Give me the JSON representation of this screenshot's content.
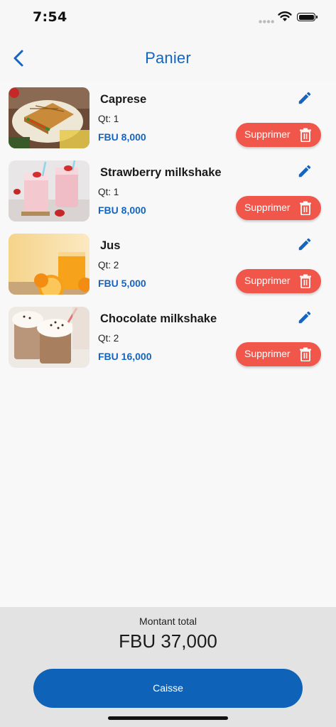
{
  "status_bar": {
    "time": "7:54"
  },
  "header": {
    "title": "Panier"
  },
  "cart": {
    "items": [
      {
        "name": "Caprese",
        "qty": "Qt: 1",
        "price": "FBU 8,000",
        "delete_label": "Supprimer",
        "image": "caprese-sandwich"
      },
      {
        "name": "Strawberry milkshake",
        "qty": "Qt: 1",
        "price": "FBU 8,000",
        "delete_label": "Supprimer",
        "image": "strawberry-milkshake"
      },
      {
        "name": "Jus",
        "qty": "Qt: 2",
        "price": "FBU 5,000",
        "delete_label": "Supprimer",
        "image": "orange-juice"
      },
      {
        "name": "Chocolate milkshake",
        "qty": "Qt: 2",
        "price": "FBU 16,000",
        "delete_label": "Supprimer",
        "image": "chocolate-milkshake"
      }
    ]
  },
  "footer": {
    "total_label": "Montant total",
    "total_value": "FBU 37,000",
    "checkout_label": "Caisse"
  },
  "colors": {
    "accent": "#1565c0",
    "checkout_button": "#0e63b8",
    "delete_button": "#f0574a",
    "footer_bg": "#e3e3e3"
  },
  "icons": [
    "back-chevron-icon",
    "edit-pencil-icon",
    "trash-icon",
    "wifi-icon",
    "battery-icon",
    "signal-icon"
  ]
}
